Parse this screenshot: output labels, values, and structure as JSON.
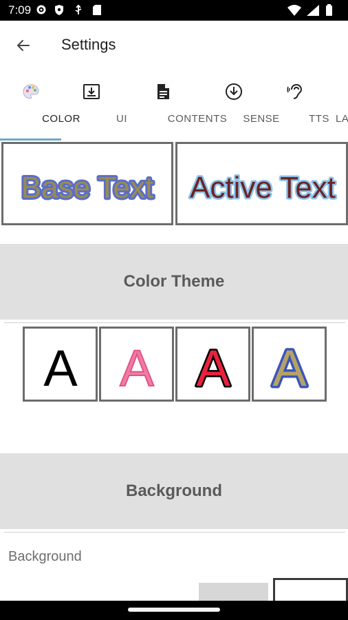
{
  "status_bar": {
    "time": "7:09",
    "icons": [
      "gear-icon",
      "shield-icon",
      "usb-icon",
      "sd-card-icon"
    ],
    "right_icons": [
      "wifi-icon",
      "signal-icon",
      "battery-icon"
    ]
  },
  "app_bar": {
    "title": "Settings",
    "back_icon": "arrow-left-icon"
  },
  "tabs": [
    {
      "label": "COLOR",
      "icon": "palette-icon",
      "active": true
    },
    {
      "label": "UI",
      "icon": "download-box-icon",
      "active": false
    },
    {
      "label": "CONTENTS",
      "icon": "document-icon",
      "active": false
    },
    {
      "label": "SENSE",
      "icon": "arrow-down-circle-icon",
      "active": false
    },
    {
      "label": "TTS",
      "icon": "ear-icon",
      "active": false
    },
    {
      "label": "LA",
      "icon": "",
      "active": false
    }
  ],
  "previews": {
    "base_text": "Base Text",
    "active_text": "Active Text"
  },
  "sections": {
    "color_theme": "Color Theme",
    "background": "Background"
  },
  "theme_tiles": [
    {
      "letter": "A",
      "fill": "#000000",
      "stroke": "none"
    },
    {
      "letter": "A",
      "fill": "#f07ca4",
      "stroke": "#e05588"
    },
    {
      "letter": "A",
      "fill": "#e8213f",
      "stroke": "#000000"
    },
    {
      "letter": "A",
      "fill": "#b5a267",
      "stroke": "#3b55b8"
    }
  ],
  "background_field": {
    "label": "Background"
  },
  "colors": {
    "accent": "#6fa8c8",
    "section_bg": "#e0e0e0",
    "base_text_fill": "#9a8b53",
    "base_text_stroke": "#5a6ec7",
    "active_text_fill": "#6b2323",
    "active_text_stroke": "#8fc3e8"
  }
}
